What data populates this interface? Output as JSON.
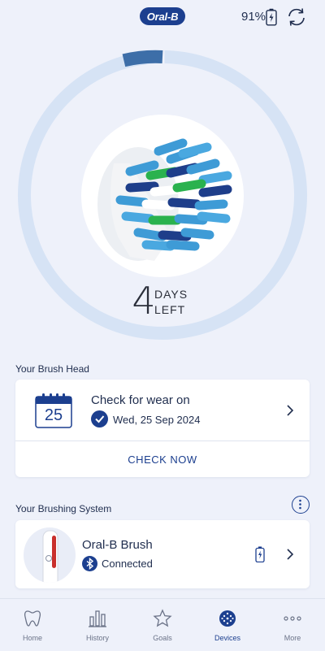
{
  "header": {
    "logo_text": "Oral-B",
    "battery_percent": "91%",
    "icons": [
      "battery-charging-icon",
      "sync-icon"
    ]
  },
  "brush_head_status": {
    "days_left": "4",
    "days_label_line1": "DAYS",
    "days_label_line2": "LEFT",
    "life_remaining_fraction": 0.95
  },
  "brush_head_section": {
    "title": "Your Brush Head",
    "calendar_day": "25",
    "wear_title": "Check for wear on",
    "wear_date": "Wed, 25 Sep 2024",
    "action_label": "CHECK NOW"
  },
  "brushing_system_section": {
    "title": "Your Brushing System",
    "device_name": "Oral-B Brush",
    "connection_status": "Connected"
  },
  "bottom_nav": {
    "items": [
      {
        "label": "Home",
        "icon": "tooth-icon"
      },
      {
        "label": "History",
        "icon": "bar-chart-icon"
      },
      {
        "label": "Goals",
        "icon": "star-icon"
      },
      {
        "label": "Devices",
        "icon": "brush-head-icon",
        "active": true
      },
      {
        "label": "More",
        "icon": "more-dots-icon"
      }
    ]
  },
  "colors": {
    "brand_blue": "#1c3f8f",
    "gauge_track": "#d6e3f5",
    "gauge_marker": "#3d6ea8",
    "background": "#eef1fa"
  }
}
